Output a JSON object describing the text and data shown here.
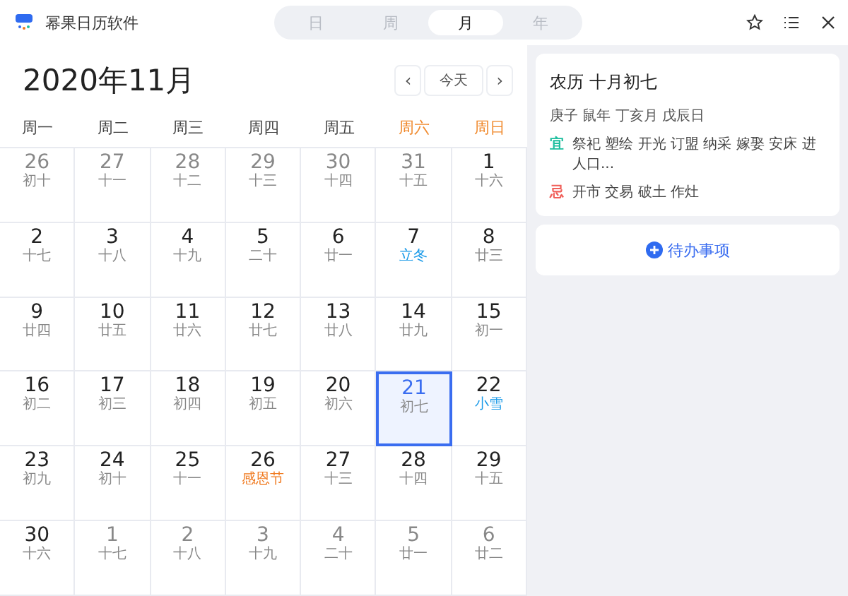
{
  "window": {
    "title": "幂果日历软件"
  },
  "view_tabs": [
    {
      "label": "日",
      "selected": false
    },
    {
      "label": "周",
      "selected": false
    },
    {
      "label": "月",
      "selected": true
    },
    {
      "label": "年",
      "selected": false
    }
  ],
  "header": {
    "month_title": "2020年11月",
    "prev": "‹",
    "today": "今天",
    "next": "›"
  },
  "weekdays": [
    {
      "label": "周一",
      "weekend": false
    },
    {
      "label": "周二",
      "weekend": false
    },
    {
      "label": "周三",
      "weekend": false
    },
    {
      "label": "周四",
      "weekend": false
    },
    {
      "label": "周五",
      "weekend": false
    },
    {
      "label": "周六",
      "weekend": true
    },
    {
      "label": "周日",
      "weekend": true
    }
  ],
  "days": [
    {
      "day": "26",
      "lunar": "初十",
      "kind": "normal",
      "muted": true,
      "selected": false
    },
    {
      "day": "27",
      "lunar": "十一",
      "kind": "normal",
      "muted": true,
      "selected": false
    },
    {
      "day": "28",
      "lunar": "十二",
      "kind": "normal",
      "muted": true,
      "selected": false
    },
    {
      "day": "29",
      "lunar": "十三",
      "kind": "normal",
      "muted": true,
      "selected": false
    },
    {
      "day": "30",
      "lunar": "十四",
      "kind": "normal",
      "muted": true,
      "selected": false
    },
    {
      "day": "31",
      "lunar": "十五",
      "kind": "normal",
      "muted": true,
      "selected": false
    },
    {
      "day": "1",
      "lunar": "十六",
      "kind": "normal",
      "muted": false,
      "selected": false
    },
    {
      "day": "2",
      "lunar": "十七",
      "kind": "normal",
      "muted": false,
      "selected": false
    },
    {
      "day": "3",
      "lunar": "十八",
      "kind": "normal",
      "muted": false,
      "selected": false
    },
    {
      "day": "4",
      "lunar": "十九",
      "kind": "normal",
      "muted": false,
      "selected": false
    },
    {
      "day": "5",
      "lunar": "二十",
      "kind": "normal",
      "muted": false,
      "selected": false
    },
    {
      "day": "6",
      "lunar": "廿一",
      "kind": "normal",
      "muted": false,
      "selected": false
    },
    {
      "day": "7",
      "lunar": "立冬",
      "kind": "term",
      "muted": false,
      "selected": false
    },
    {
      "day": "8",
      "lunar": "廿三",
      "kind": "normal",
      "muted": false,
      "selected": false
    },
    {
      "day": "9",
      "lunar": "廿四",
      "kind": "normal",
      "muted": false,
      "selected": false
    },
    {
      "day": "10",
      "lunar": "廿五",
      "kind": "normal",
      "muted": false,
      "selected": false
    },
    {
      "day": "11",
      "lunar": "廿六",
      "kind": "normal",
      "muted": false,
      "selected": false
    },
    {
      "day": "12",
      "lunar": "廿七",
      "kind": "normal",
      "muted": false,
      "selected": false
    },
    {
      "day": "13",
      "lunar": "廿八",
      "kind": "normal",
      "muted": false,
      "selected": false
    },
    {
      "day": "14",
      "lunar": "廿九",
      "kind": "normal",
      "muted": false,
      "selected": false
    },
    {
      "day": "15",
      "lunar": "初一",
      "kind": "normal",
      "muted": false,
      "selected": false
    },
    {
      "day": "16",
      "lunar": "初二",
      "kind": "normal",
      "muted": false,
      "selected": false
    },
    {
      "day": "17",
      "lunar": "初三",
      "kind": "normal",
      "muted": false,
      "selected": false
    },
    {
      "day": "18",
      "lunar": "初四",
      "kind": "normal",
      "muted": false,
      "selected": false
    },
    {
      "day": "19",
      "lunar": "初五",
      "kind": "normal",
      "muted": false,
      "selected": false
    },
    {
      "day": "20",
      "lunar": "初六",
      "kind": "normal",
      "muted": false,
      "selected": false
    },
    {
      "day": "21",
      "lunar": "初七",
      "kind": "normal",
      "muted": false,
      "selected": true
    },
    {
      "day": "22",
      "lunar": "小雪",
      "kind": "term",
      "muted": false,
      "selected": false
    },
    {
      "day": "23",
      "lunar": "初九",
      "kind": "normal",
      "muted": false,
      "selected": false
    },
    {
      "day": "24",
      "lunar": "初十",
      "kind": "normal",
      "muted": false,
      "selected": false
    },
    {
      "day": "25",
      "lunar": "十一",
      "kind": "normal",
      "muted": false,
      "selected": false
    },
    {
      "day": "26",
      "lunar": "感恩节",
      "kind": "festival",
      "muted": false,
      "selected": false
    },
    {
      "day": "27",
      "lunar": "十三",
      "kind": "normal",
      "muted": false,
      "selected": false
    },
    {
      "day": "28",
      "lunar": "十四",
      "kind": "normal",
      "muted": false,
      "selected": false
    },
    {
      "day": "29",
      "lunar": "十五",
      "kind": "normal",
      "muted": false,
      "selected": false
    },
    {
      "day": "30",
      "lunar": "十六",
      "kind": "normal",
      "muted": false,
      "selected": false
    },
    {
      "day": "1",
      "lunar": "十七",
      "kind": "normal",
      "muted": true,
      "selected": false
    },
    {
      "day": "2",
      "lunar": "十八",
      "kind": "normal",
      "muted": true,
      "selected": false
    },
    {
      "day": "3",
      "lunar": "十九",
      "kind": "normal",
      "muted": true,
      "selected": false
    },
    {
      "day": "4",
      "lunar": "二十",
      "kind": "normal",
      "muted": true,
      "selected": false
    },
    {
      "day": "5",
      "lunar": "廿一",
      "kind": "normal",
      "muted": true,
      "selected": false
    },
    {
      "day": "6",
      "lunar": "廿二",
      "kind": "normal",
      "muted": true,
      "selected": false
    }
  ],
  "detail": {
    "lunar_date": "农历 十月初七",
    "ganzhi": "庚子 鼠年 丁亥月 戊辰日",
    "almanac": [
      {
        "tag": "宜",
        "color": "#1fbf9f",
        "items": "祭祀 塑绘 开光 订盟 纳采 嫁娶 安床 进人口..."
      },
      {
        "tag": "忌",
        "color": "#f0605a",
        "items": "开市 交易 破土 作灶"
      }
    ]
  },
  "todo": {
    "label": "待办事项"
  }
}
